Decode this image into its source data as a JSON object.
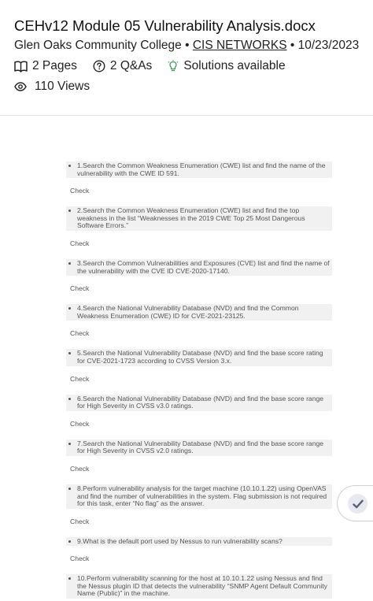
{
  "header": {
    "title": "CEHv12 Module 05 Vulnerability Analysis.docx",
    "school": "Glen Oaks Community College",
    "separator": "•",
    "course": "CIS NETWORKS",
    "date": "10/23/2023",
    "pages_label": "2 Pages",
    "qas_label": "2 Q&As",
    "solutions_label": "Solutions available",
    "views_label": "110 Views",
    "accent_color": "#3a9a5c"
  },
  "questions": [
    {
      "text": "1.Search the Common Weakness Enumeration (CWE) list and find the name of the vulnerability with the CWE ID 591.",
      "check": "Check"
    },
    {
      "text": "2.Search the Common Weakness Enumeration (CWE) list and find the top weakness in the list “Weaknesses in the 2019 CWE Top 25 Most Dangerous Software Errors.”",
      "check": "Check"
    },
    {
      "text": "3.Search the Common Vulnerabilities and Exposures (CVE) list and find the name of the vulnerability with the CVE ID CVE-2020-17140.",
      "check": "Check"
    },
    {
      "text": "4.Search the National Vulnerability Database (NVD) and find the Common Weakness Enumeration (CWE) ID for CVE-2021-23125.",
      "check": "Check"
    },
    {
      "text": "5.Search the National Vulnerability Database (NVD) and find the base score rating for CVE-2021-1723 according to CVSS Version 3.x.",
      "check": "Check"
    },
    {
      "text": "6.Search the National Vulnerability Database (NVD) and find the base score range for High Severity in CVSS v3.0 ratings.",
      "check": "Check"
    },
    {
      "text": "7.Search the National Vulnerability Database (NVD) and find the base score range for High Severity in CVSS v2.0 ratings.",
      "check": "Check"
    },
    {
      "text": "8.Perform vulnerability analysis for the target machine (10.10.1.22) using OpenVAS and find the number of vulnerabilities in the system. Flag submission is not required for this task, enter “No flag” as the answer.",
      "check": "Check"
    },
    {
      "text": "9.What is the default port used by Nessus to run vulnerability scans?",
      "check": "Check"
    },
    {
      "text": "10.Perform vulnerability scanning for the host at 10.10.1.22 using Nessus and find the Nessus plugin ID that detects the vulnerability “SNMP Agent Default Community Name (Public)” in the machine.",
      "check": ""
    }
  ],
  "fab": {
    "icon": "checkmark-icon"
  }
}
